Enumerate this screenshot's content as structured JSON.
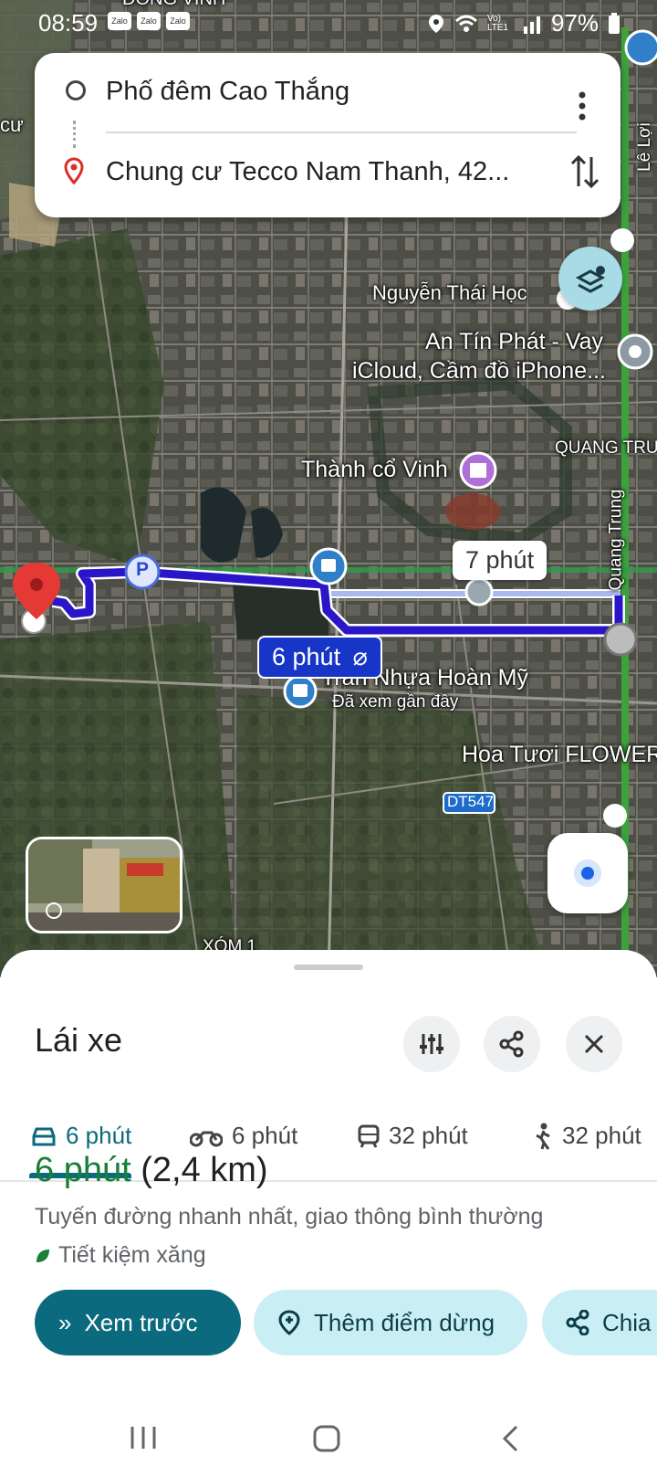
{
  "status_bar": {
    "time": "08:59",
    "apps": [
      "Zalo",
      "Zalo",
      "Zalo"
    ],
    "network_label": "Vo) LTE1",
    "battery": "97%"
  },
  "route_card": {
    "origin": "Phố đêm Cao Thắng",
    "destination": "Chung cư Tecco Nam Thanh, 42...",
    "icons": [
      "origin-circle-icon",
      "destination-pin-icon",
      "more-vert-icon",
      "swap-icon"
    ]
  },
  "map": {
    "labels": {
      "dong_vinh": "ĐÔNG VĨNH",
      "nguyen_thai_hoc": "Nguyễn Thái Học",
      "an_tin_phat_1": "An Tín Phát - Vay",
      "an_tin_phat_2": "iCloud, Cầm đồ iPhone...",
      "quang_trung": "QUANG TRU",
      "thanh_co_vinh": "Thành cổ Vinh",
      "quang_trung_road": "Quang Trung",
      "le_loi": "Lê Lợi",
      "tran_nhua": "Trần Nhựa Hoàn Mỹ",
      "da_xem": "Đã xem gần đây",
      "hoa_tuoi": "Hoa Tươi FLOWER",
      "dt547": "DT547",
      "xom1": "XÓM 1",
      "cu": "cư"
    },
    "chips": {
      "alt_route": "7 phút",
      "main_route": "6 phút"
    },
    "parking_label": "P"
  },
  "sheet": {
    "title": "Lái xe",
    "tabs": [
      {
        "label": "6 phút",
        "icon": "car-icon"
      },
      {
        "label": "6 phút",
        "icon": "motorbike-icon"
      },
      {
        "label": "32 phút",
        "icon": "transit-icon"
      },
      {
        "label": "32 phút",
        "icon": "walk-icon"
      }
    ],
    "summary_time": "6 phút",
    "summary_distance": "(2,4 km)",
    "route_desc": "Tuyến đường nhanh nhất, giao thông bình thường",
    "eco_label": "Tiết kiệm xăng",
    "actions": {
      "preview": "Xem trước",
      "add_stop": "Thêm điểm dừng",
      "share": "Chia"
    }
  },
  "colors": {
    "accent": "#0b6a7d",
    "route": "#1736c7",
    "green": "#188038"
  }
}
